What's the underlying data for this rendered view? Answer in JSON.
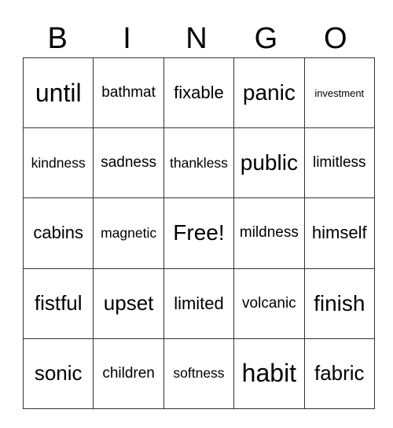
{
  "header": [
    "B",
    "I",
    "N",
    "G",
    "O"
  ],
  "rows": [
    [
      "until",
      "bathmat",
      "fixable",
      "panic",
      "investment"
    ],
    [
      "kindness",
      "sadness",
      "thankless",
      "public",
      "limitless"
    ],
    [
      "cabins",
      "magnetic",
      "Free!",
      "mildness",
      "himself"
    ],
    [
      "fistful",
      "upset",
      "limited",
      "volcanic",
      "finish"
    ],
    [
      "sonic",
      "children",
      "softness",
      "habit",
      "fabric"
    ]
  ]
}
